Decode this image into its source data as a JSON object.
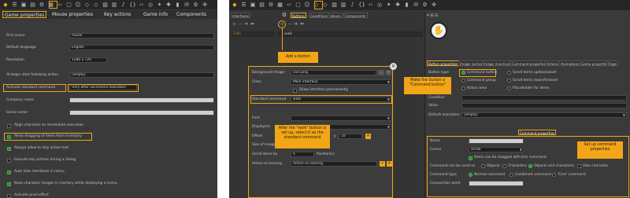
{
  "colors": {
    "accent": "#f2a516",
    "panel": "#3a3a3a",
    "toolbar": "#262626",
    "check": "#2e8b3a"
  },
  "left": {
    "toolbar_icons": [
      "logo-icon",
      "menu-icon",
      "folder-icon",
      "save-icon",
      "gear-icon",
      "cube-icon",
      "code-icon",
      "box-icon",
      "person-icon",
      "gem-icon",
      "gem-icon",
      "image-icon",
      "film-icon",
      "speaker-icon",
      "braces-icon",
      "code-icon",
      "globe-icon",
      "sparkle-icon",
      "puzzle-icon",
      "chart-icon",
      "stamp-icon",
      "gear-icon",
      "gamepad-icon"
    ],
    "tabs": [
      "Game properties",
      "Mouse properties",
      "Key actions",
      "Game info",
      "Components"
    ],
    "fields": [
      {
        "label": "First scene",
        "value": "house"
      },
      {
        "label": "Default language",
        "value": "English"
      },
      {
        "label": "Resolution",
        "value": "1280 x 720"
      },
      {
        "label": "At begin start following action",
        "value": "[empty]"
      },
      {
        "label": "Activate standard command",
        "value": "Only after successful execution"
      },
      {
        "label": "Company name",
        "value": ""
      },
      {
        "label": "Game name",
        "value": ""
      }
    ],
    "checkboxes": [
      {
        "label": "Align character on immediate execution",
        "checked": false
      },
      {
        "label": "Allow dragging of items from inventory",
        "checked": true
      },
      {
        "label": "Always allow to skip active text",
        "checked": true
      },
      {
        "label": "Execute key actions during a dialog",
        "checked": false
      },
      {
        "label": "Auto hide interfaces in menu",
        "checked": true
      },
      {
        "label": "Keep character images in memory while displaying a menu",
        "checked": true
      },
      {
        "label": "Activate pixel effect",
        "checked": false
      }
    ]
  },
  "right": {
    "toolbar_icons": [
      "logo-icon",
      "menu-icon",
      "folder-icon",
      "save-icon",
      "gear-icon",
      "cube-icon",
      "code-icon",
      "box-icon",
      "person-icon",
      "gem-icon",
      "gem-icon",
      "image-icon",
      "film-icon",
      "speaker-icon",
      "braces-icon",
      "code-icon",
      "globe-icon",
      "sparkle-icon",
      "puzzle-icon",
      "chart-icon",
      "stamp-icon",
      "gear-icon",
      "gamepad-icon"
    ],
    "outer_tabs": [
      "Interfaces",
      "Buttons",
      "Conditions",
      "Values",
      "Components"
    ],
    "list_columns": [
      "Coin",
      "walk"
    ],
    "callout_add": "Add a button",
    "callout_command": "Make the button a \"Command button\"",
    "callout_setup": "Set up command properties",
    "callout_walk": "After the \"walk\" button is set up, select it as the standard command",
    "dialog": {
      "fields": [
        {
          "label": "Background image",
          "value": "coin.png"
        },
        {
          "label": "Class",
          "value": "Main interface"
        },
        {
          "label": "Standard command",
          "value": "walk"
        },
        {
          "label": "Font",
          "value": ""
        },
        {
          "label": "Displayme",
          "value": ""
        },
        {
          "label": "Offset",
          "x_label": "x",
          "x": "50",
          "y_label": "y",
          "y": "10"
        },
        {
          "label": "Size of image (pixel)",
          "x_label": "-1",
          "y_label": "x",
          "y": "-1"
        },
        {
          "label": "Scroll items by",
          "value": "5",
          "suffix": "Position(s)"
        },
        {
          "label": "Action on leaving",
          "value": "Action on leaving"
        }
      ],
      "show_permanently": "Show interface permanently"
    },
    "prop_tabs": [
      "Button properties",
      "Image (active)",
      "Image (inactive)",
      "Command properties",
      "Actions",
      "Animations",
      "Game properties",
      "Flags"
    ],
    "button_type_label": "Button type",
    "button_types": [
      {
        "label": "Command button",
        "selected": true
      },
      {
        "label": "Scroll items up/backward",
        "selected": false
      },
      {
        "label": "Command group",
        "selected": false
      },
      {
        "label": "Scroll items down/forward",
        "selected": false
      },
      {
        "label": "Action area",
        "selected": false
      },
      {
        "label": "Placeholder for items",
        "selected": false
      }
    ],
    "condition_label": "Condition",
    "value_label": "Value",
    "default_animation_label": "Default animation",
    "default_animation_value": "[empty]",
    "cmd_tab": "Command properties",
    "cmd": {
      "name_label": "Name",
      "cursor_label": "Cursor",
      "cursor_value": "arrow",
      "items_drag": "Items can be dragged with this command",
      "used_on_label": "Command can be used on",
      "used_on": [
        {
          "label": "Objects",
          "selected": false
        },
        {
          "label": "Characters",
          "selected": false
        },
        {
          "label": "Objects and characters",
          "selected": true
        },
        {
          "label": "Own character",
          "selected": false
        }
      ],
      "type_label": "Command type",
      "types": [
        {
          "label": "Normal command",
          "selected": true
        },
        {
          "label": "Combined command",
          "selected": false
        },
        {
          "label": "'Give' command",
          "selected": false
        }
      ],
      "conj_label": "Conjunction word"
    }
  }
}
